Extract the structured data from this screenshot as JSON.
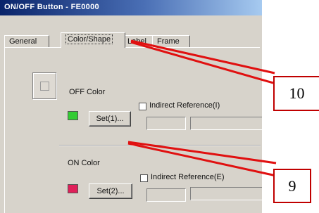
{
  "window": {
    "title": "ON/OFF Button - FE0000"
  },
  "tabs": [
    {
      "label": "General"
    },
    {
      "label": "Color/Shape"
    },
    {
      "label": "Label"
    },
    {
      "label": "Frame"
    }
  ],
  "off_color": {
    "label": "OFF Color",
    "set_button": "Set(1)...",
    "indirect_checkbox": "Indirect Reference(I)",
    "swatch_color": "#33cc33"
  },
  "on_color": {
    "label": "ON Color",
    "set_button": "Set(2)...",
    "indirect_checkbox": "Indirect Reference(E)",
    "swatch_color": "#e0205a"
  },
  "callouts": {
    "tab_callout": "10",
    "section_callout": "9"
  },
  "colors": {
    "arrow": "#e01010",
    "callout_border": "#c00000",
    "title_bar": "#0a246a"
  }
}
